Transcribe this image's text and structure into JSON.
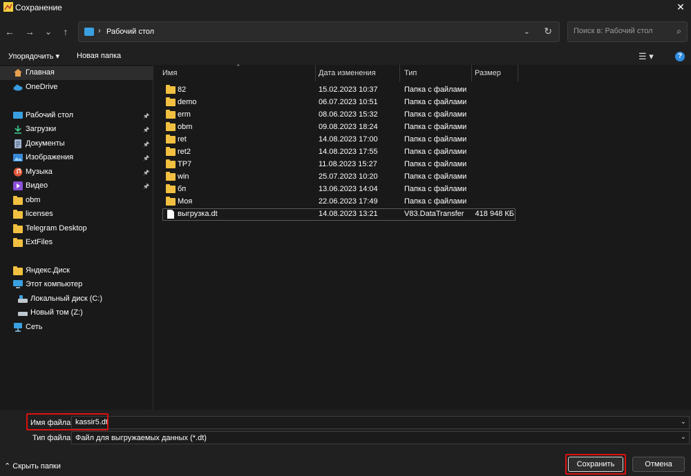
{
  "window": {
    "title": "Сохранение",
    "close": "✕"
  },
  "nav": {
    "back": "←",
    "forward": "→",
    "recent": "⌄",
    "up": "↑",
    "address": {
      "separator": "›",
      "path": "Рабочий стол",
      "dropdown": "⌄",
      "refresh": "↻"
    },
    "search_placeholder": "Поиск в: Рабочий стол",
    "search_icon": "⌕"
  },
  "toolbar": {
    "organize": "Упорядочить ▾",
    "new_folder": "Новая папка",
    "view_icon": "☰ ▾",
    "help_icon": "?"
  },
  "sidebar": {
    "items": [
      {
        "label": "Главная",
        "icon": "home-icon"
      },
      {
        "label": "OneDrive",
        "icon": "cloud-icon"
      },
      {
        "label": "Рабочий стол",
        "icon": "desktop-icon",
        "pin": "📌"
      },
      {
        "label": "Загрузки",
        "icon": "download-icon",
        "pin": "📌"
      },
      {
        "label": "Документы",
        "icon": "documents-icon",
        "pin": "📌"
      },
      {
        "label": "Изображения",
        "icon": "pictures-icon",
        "pin": "📌"
      },
      {
        "label": "Музыка",
        "icon": "music-icon",
        "pin": "📌"
      },
      {
        "label": "Видео",
        "icon": "video-icon",
        "pin": "📌"
      },
      {
        "label": "obm",
        "icon": "folder-icon"
      },
      {
        "label": "licenses",
        "icon": "folder-icon"
      },
      {
        "label": "Telegram Desktop",
        "icon": "folder-icon"
      },
      {
        "label": "ExtFiles",
        "icon": "folder-icon"
      },
      {
        "label": "Яндекс.Диск",
        "icon": "folder-icon"
      },
      {
        "label": "Этот компьютер",
        "icon": "computer-icon"
      },
      {
        "label": "Локальный диск (C:)",
        "icon": "drive-icon"
      },
      {
        "label": "Новый том (Z:)",
        "icon": "drive-icon"
      },
      {
        "label": "Сеть",
        "icon": "network-icon"
      }
    ]
  },
  "files": {
    "sort_indicator": "⌃",
    "columns": {
      "name": "Имя",
      "date": "Дата изменения",
      "type": "Тип",
      "size": "Размер"
    },
    "rows": [
      {
        "name": "82",
        "date": "15.02.2023 10:37",
        "type": "Папка с файлами",
        "size": ""
      },
      {
        "name": "demo",
        "date": "06.07.2023 10:51",
        "type": "Папка с файлами",
        "size": ""
      },
      {
        "name": "erm",
        "date": "08.06.2023 15:32",
        "type": "Папка с файлами",
        "size": ""
      },
      {
        "name": "obm",
        "date": "09.08.2023 18:24",
        "type": "Папка с файлами",
        "size": ""
      },
      {
        "name": "ret",
        "date": "14.08.2023 17:00",
        "type": "Папка с файлами",
        "size": ""
      },
      {
        "name": "ret2",
        "date": "14.08.2023 17:55",
        "type": "Папка с файлами",
        "size": ""
      },
      {
        "name": "TP7",
        "date": "11.08.2023 15:27",
        "type": "Папка с файлами",
        "size": ""
      },
      {
        "name": "win",
        "date": "25.07.2023 10:20",
        "type": "Папка с файлами",
        "size": ""
      },
      {
        "name": "бп",
        "date": "13.06.2023 14:04",
        "type": "Папка с файлами",
        "size": ""
      },
      {
        "name": "Моя",
        "date": "22.06.2023 17:49",
        "type": "Папка с файлами",
        "size": ""
      },
      {
        "name": "выгрузка.dt",
        "date": "14.08.2023 13:21",
        "type": "V83.DataTransfer",
        "size": "418 948 КБ"
      }
    ]
  },
  "form": {
    "filename_label": "Имя файла:",
    "filename_value": "kassir5.dt",
    "filetype_label": "Тип файла:",
    "filetype_value": "Файл для выгружаемых данных (*.dt)",
    "dropdown": "⌄",
    "hide_folders": "⌃  Скрыть папки",
    "save": "Сохранить",
    "cancel": "Отмена"
  },
  "colors": {
    "folder": "#f2c040",
    "highlight": "#e01010",
    "accent": "#2f8be0"
  }
}
